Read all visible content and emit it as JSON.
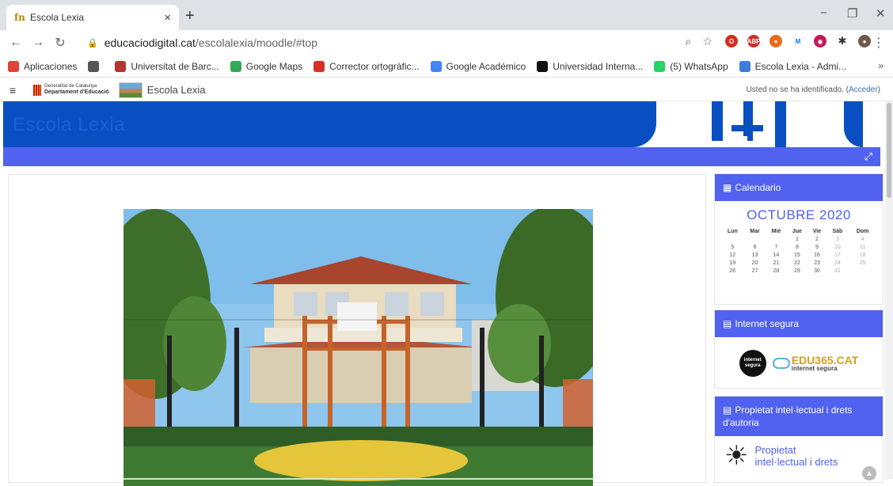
{
  "browser": {
    "tab_title": "Escola Lexia",
    "tab_favicon": "fn",
    "new_tab_label": "+",
    "close_tab_label": "×",
    "url_host": "educaciodigital.cat",
    "url_path": "/escolalexia/moodle/#top",
    "window_controls": {
      "minimize": "−",
      "restore": "❐",
      "close": "✕"
    },
    "nav_icons": [
      "back-arrow-icon",
      "forward-arrow-icon",
      "reload-icon",
      "lock-icon"
    ]
  },
  "bookmarks": [
    {
      "label": "Aplicaciones",
      "icon": "apps-grid-icon",
      "color": "#e34234"
    },
    {
      "label": "",
      "icon": "globe-icon",
      "color": "#555555"
    },
    {
      "label": "Universitat de Barc...",
      "icon": "university-icon",
      "color": "#b5342e"
    },
    {
      "label": "Google Maps",
      "icon": "maps-pin-icon",
      "color": "#34a853"
    },
    {
      "label": "Corrector ortogràfic...",
      "icon": "sc-icon",
      "color": "#d93025"
    },
    {
      "label": "Google Académico",
      "icon": "scholar-icon",
      "color": "#4285f4"
    },
    {
      "label": "Universidad Interna...",
      "icon": "unir-icon",
      "color": "#111111"
    },
    {
      "label": "(5) WhatsApp",
      "icon": "whatsapp-icon",
      "color": "#25d366"
    },
    {
      "label": "Escola Lexia - Admi...",
      "icon": "lexia-icon",
      "color": "#3b7dd8"
    }
  ],
  "bookmarks_more": "»",
  "moodle_nav": {
    "gencat_line1": "Generalitat de Catalunya",
    "gencat_line2": "Departament d'Educació",
    "site_name": "Escola Lexia",
    "login_text": "Usted no se ha identificado. (",
    "login_link": "Acceder",
    "login_close": ")"
  },
  "header": {
    "title": "Escola Lexia",
    "expand_icon": "expand-icon"
  },
  "calendar": {
    "heading": "Calendario",
    "month": "OCTUBRE 2020",
    "weekdays": [
      "Lun",
      "Mar",
      "Mié",
      "Jue",
      "Vie",
      "Sáb",
      "Dom"
    ],
    "weeks": [
      [
        "",
        "",
        "",
        "1",
        "2",
        "3",
        "4"
      ],
      [
        "5",
        "6",
        "7",
        "8",
        "9",
        "10",
        "11"
      ],
      [
        "12",
        "13",
        "14",
        "15",
        "16",
        "17",
        "18"
      ],
      [
        "19",
        "20",
        "21",
        "22",
        "23",
        "24",
        "25"
      ],
      [
        "26",
        "27",
        "28",
        "29",
        "30",
        "31",
        ""
      ]
    ]
  },
  "internet_segura": {
    "heading": "Internet segura",
    "logo1_text": "internet segura",
    "logo2_text": "EDU365.CAT",
    "logo2_sub": "internet segura"
  },
  "propietat": {
    "heading": "Propietat intel·lectual i drets d'autoria",
    "body_line1": "Propietat",
    "body_line2": "intel·lectual i drets"
  },
  "colors": {
    "brand_blue": "#0a4fc2",
    "accent": "#5161f0"
  }
}
